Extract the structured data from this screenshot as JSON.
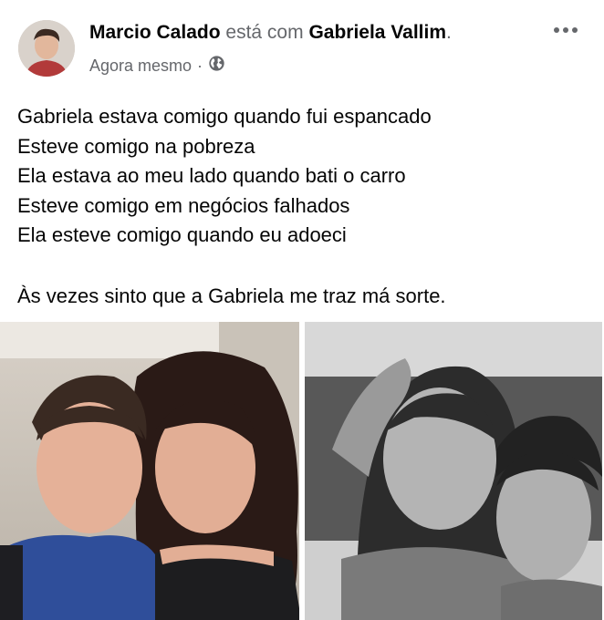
{
  "post": {
    "author": "Marcio Calado",
    "with_text": "está com",
    "tagged": "Gabriela Vallim",
    "period": ".",
    "time": "Agora mesmo",
    "separator": "·",
    "body_lines": [
      "Gabriela estava comigo quando fui espancado",
      "Esteve comigo na pobreza",
      "Ela estava ao meu lado quando bati o carro",
      "Esteve comigo em negócios falhados",
      "Ela esteve comigo quando eu adoeci"
    ],
    "closing_line": "Às vezes sinto que a Gabriela me traz má sorte."
  },
  "icons": {
    "privacy": "globe-icon",
    "more": "more-options-icon"
  },
  "colors": {
    "text_primary": "#050505",
    "text_secondary": "#65676b"
  }
}
